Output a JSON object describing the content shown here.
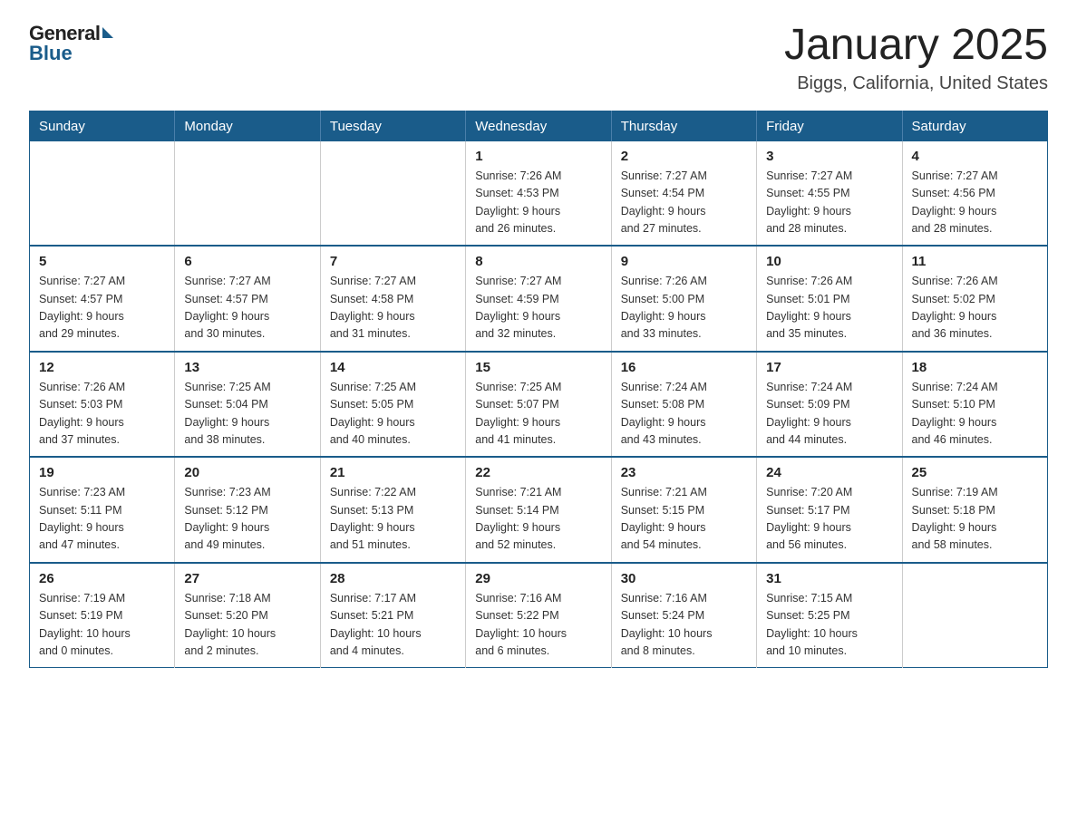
{
  "header": {
    "logo": {
      "general": "General",
      "blue": "Blue"
    },
    "title": "January 2025",
    "subtitle": "Biggs, California, United States"
  },
  "calendar": {
    "days_of_week": [
      "Sunday",
      "Monday",
      "Tuesday",
      "Wednesday",
      "Thursday",
      "Friday",
      "Saturday"
    ],
    "weeks": [
      [
        {
          "day": "",
          "info": ""
        },
        {
          "day": "",
          "info": ""
        },
        {
          "day": "",
          "info": ""
        },
        {
          "day": "1",
          "info": "Sunrise: 7:26 AM\nSunset: 4:53 PM\nDaylight: 9 hours\nand 26 minutes."
        },
        {
          "day": "2",
          "info": "Sunrise: 7:27 AM\nSunset: 4:54 PM\nDaylight: 9 hours\nand 27 minutes."
        },
        {
          "day": "3",
          "info": "Sunrise: 7:27 AM\nSunset: 4:55 PM\nDaylight: 9 hours\nand 28 minutes."
        },
        {
          "day": "4",
          "info": "Sunrise: 7:27 AM\nSunset: 4:56 PM\nDaylight: 9 hours\nand 28 minutes."
        }
      ],
      [
        {
          "day": "5",
          "info": "Sunrise: 7:27 AM\nSunset: 4:57 PM\nDaylight: 9 hours\nand 29 minutes."
        },
        {
          "day": "6",
          "info": "Sunrise: 7:27 AM\nSunset: 4:57 PM\nDaylight: 9 hours\nand 30 minutes."
        },
        {
          "day": "7",
          "info": "Sunrise: 7:27 AM\nSunset: 4:58 PM\nDaylight: 9 hours\nand 31 minutes."
        },
        {
          "day": "8",
          "info": "Sunrise: 7:27 AM\nSunset: 4:59 PM\nDaylight: 9 hours\nand 32 minutes."
        },
        {
          "day": "9",
          "info": "Sunrise: 7:26 AM\nSunset: 5:00 PM\nDaylight: 9 hours\nand 33 minutes."
        },
        {
          "day": "10",
          "info": "Sunrise: 7:26 AM\nSunset: 5:01 PM\nDaylight: 9 hours\nand 35 minutes."
        },
        {
          "day": "11",
          "info": "Sunrise: 7:26 AM\nSunset: 5:02 PM\nDaylight: 9 hours\nand 36 minutes."
        }
      ],
      [
        {
          "day": "12",
          "info": "Sunrise: 7:26 AM\nSunset: 5:03 PM\nDaylight: 9 hours\nand 37 minutes."
        },
        {
          "day": "13",
          "info": "Sunrise: 7:25 AM\nSunset: 5:04 PM\nDaylight: 9 hours\nand 38 minutes."
        },
        {
          "day": "14",
          "info": "Sunrise: 7:25 AM\nSunset: 5:05 PM\nDaylight: 9 hours\nand 40 minutes."
        },
        {
          "day": "15",
          "info": "Sunrise: 7:25 AM\nSunset: 5:07 PM\nDaylight: 9 hours\nand 41 minutes."
        },
        {
          "day": "16",
          "info": "Sunrise: 7:24 AM\nSunset: 5:08 PM\nDaylight: 9 hours\nand 43 minutes."
        },
        {
          "day": "17",
          "info": "Sunrise: 7:24 AM\nSunset: 5:09 PM\nDaylight: 9 hours\nand 44 minutes."
        },
        {
          "day": "18",
          "info": "Sunrise: 7:24 AM\nSunset: 5:10 PM\nDaylight: 9 hours\nand 46 minutes."
        }
      ],
      [
        {
          "day": "19",
          "info": "Sunrise: 7:23 AM\nSunset: 5:11 PM\nDaylight: 9 hours\nand 47 minutes."
        },
        {
          "day": "20",
          "info": "Sunrise: 7:23 AM\nSunset: 5:12 PM\nDaylight: 9 hours\nand 49 minutes."
        },
        {
          "day": "21",
          "info": "Sunrise: 7:22 AM\nSunset: 5:13 PM\nDaylight: 9 hours\nand 51 minutes."
        },
        {
          "day": "22",
          "info": "Sunrise: 7:21 AM\nSunset: 5:14 PM\nDaylight: 9 hours\nand 52 minutes."
        },
        {
          "day": "23",
          "info": "Sunrise: 7:21 AM\nSunset: 5:15 PM\nDaylight: 9 hours\nand 54 minutes."
        },
        {
          "day": "24",
          "info": "Sunrise: 7:20 AM\nSunset: 5:17 PM\nDaylight: 9 hours\nand 56 minutes."
        },
        {
          "day": "25",
          "info": "Sunrise: 7:19 AM\nSunset: 5:18 PM\nDaylight: 9 hours\nand 58 minutes."
        }
      ],
      [
        {
          "day": "26",
          "info": "Sunrise: 7:19 AM\nSunset: 5:19 PM\nDaylight: 10 hours\nand 0 minutes."
        },
        {
          "day": "27",
          "info": "Sunrise: 7:18 AM\nSunset: 5:20 PM\nDaylight: 10 hours\nand 2 minutes."
        },
        {
          "day": "28",
          "info": "Sunrise: 7:17 AM\nSunset: 5:21 PM\nDaylight: 10 hours\nand 4 minutes."
        },
        {
          "day": "29",
          "info": "Sunrise: 7:16 AM\nSunset: 5:22 PM\nDaylight: 10 hours\nand 6 minutes."
        },
        {
          "day": "30",
          "info": "Sunrise: 7:16 AM\nSunset: 5:24 PM\nDaylight: 10 hours\nand 8 minutes."
        },
        {
          "day": "31",
          "info": "Sunrise: 7:15 AM\nSunset: 5:25 PM\nDaylight: 10 hours\nand 10 minutes."
        },
        {
          "day": "",
          "info": ""
        }
      ]
    ]
  }
}
